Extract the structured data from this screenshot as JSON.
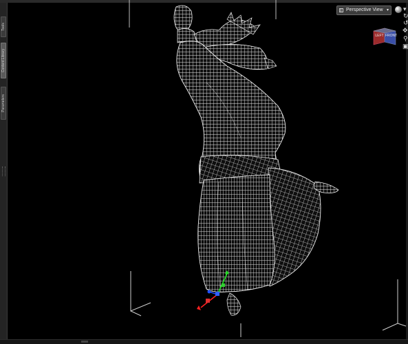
{
  "viewport": {
    "view_selector": {
      "label": "Perspective View",
      "icon": "camera-view-icon",
      "arrow": "▾"
    },
    "tools": {
      "light_sphere": "sphere-preview-icon",
      "rotate": "↻",
      "orbit": "↺",
      "pan": "✥",
      "zoom": "⚲",
      "frame": "▣"
    },
    "view_cube": {
      "left_face": "LEFT",
      "front_face": "FRONT"
    },
    "colors": {
      "background": "#000000",
      "mesh": "#e6e6e6",
      "gizmo_x": "#ff2020",
      "gizmo_y": "#20e020",
      "gizmo_z": "#2050ff"
    }
  },
  "left_rail": {
    "tabs": [
      "Tools",
      "Content Library",
      "Parameters"
    ]
  }
}
